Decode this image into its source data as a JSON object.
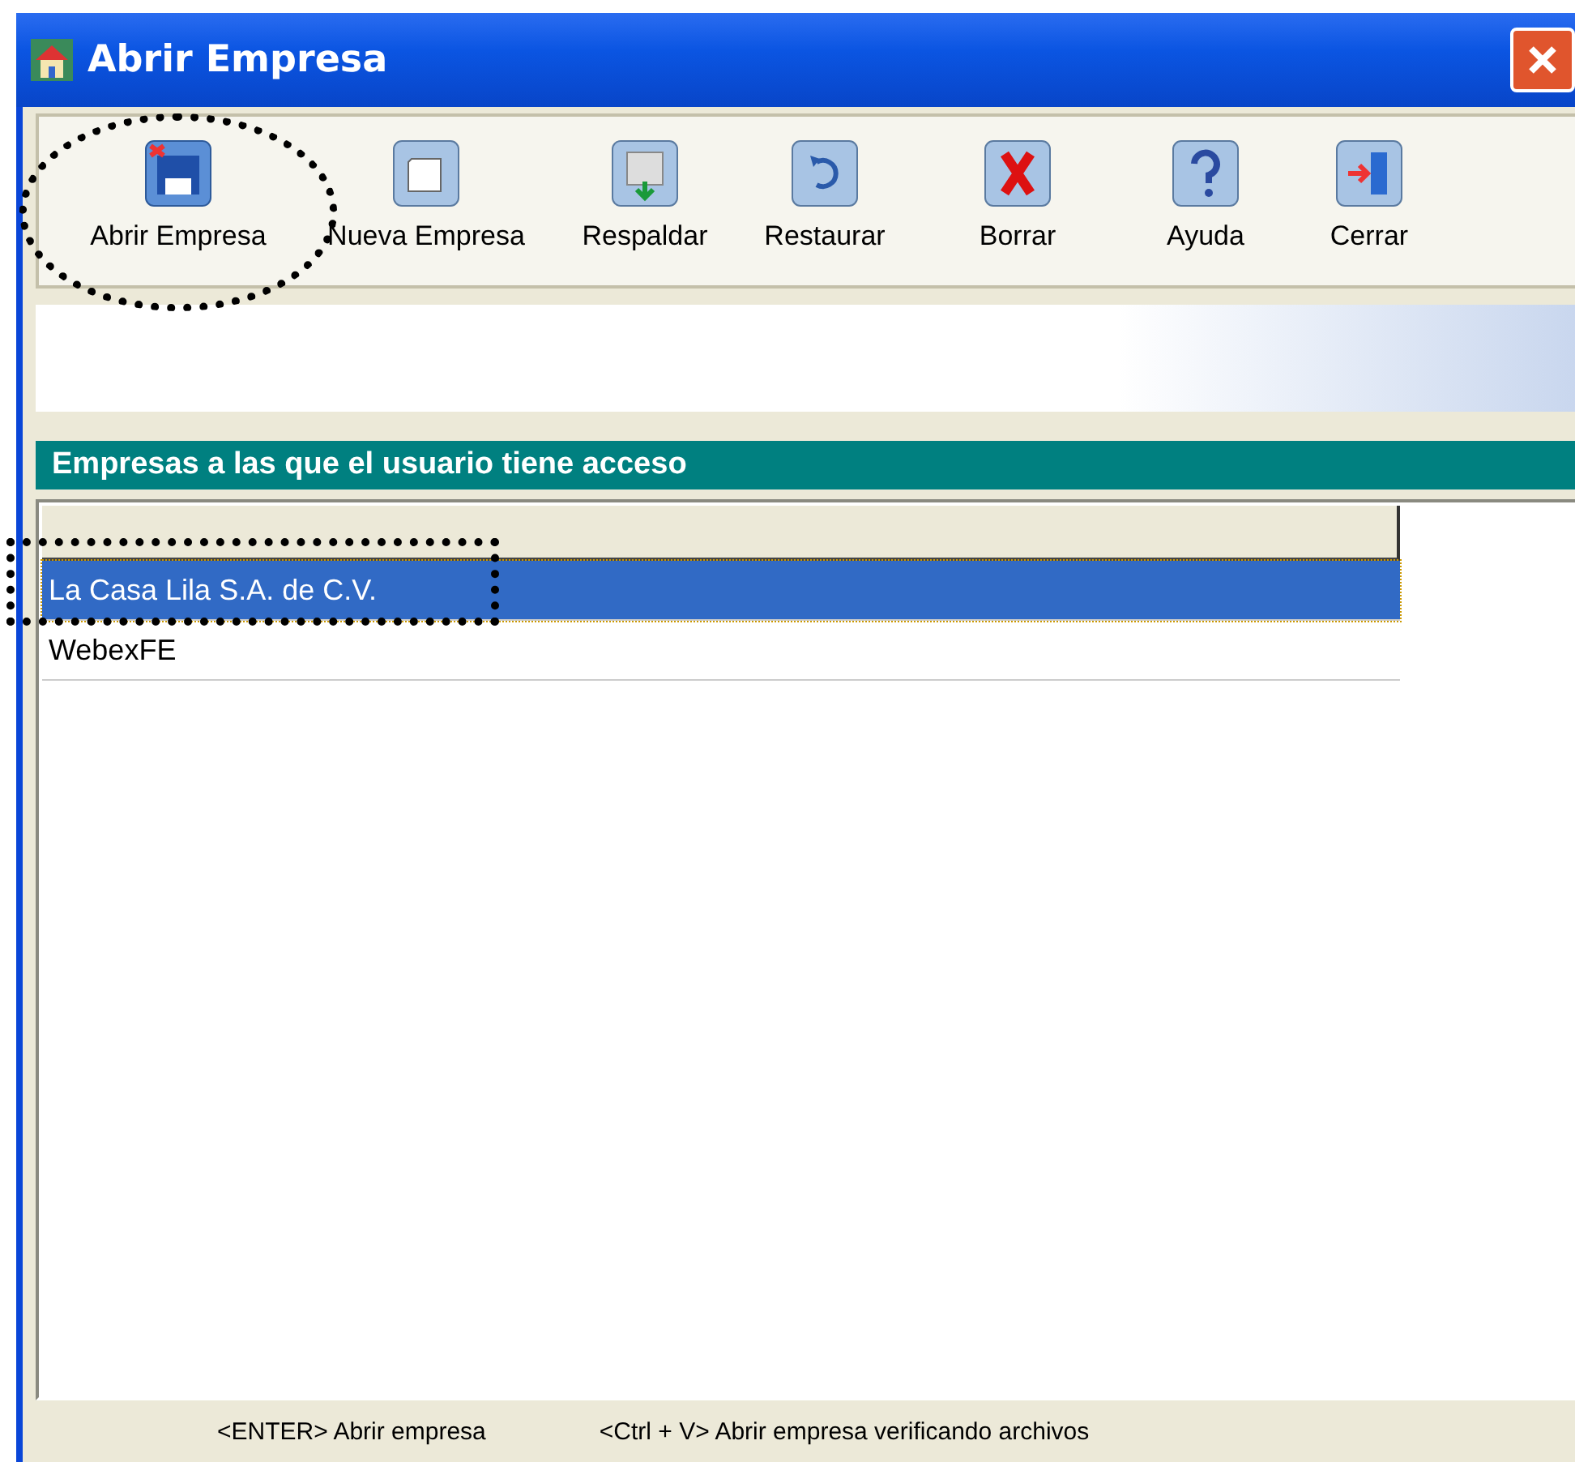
{
  "window": {
    "title": "Abrir Empresa"
  },
  "toolbar": [
    {
      "label": "Abrir Empresa",
      "kind": "open",
      "annotated": true
    },
    {
      "label": "Nueva Empresa",
      "kind": "new",
      "annotated": false
    },
    {
      "label": "Respaldar",
      "kind": "backup",
      "annotated": false
    },
    {
      "label": "Restaurar",
      "kind": "restore",
      "annotated": false
    },
    {
      "label": "Borrar",
      "kind": "delete",
      "annotated": false
    },
    {
      "label": "Ayuda",
      "kind": "help",
      "annotated": false
    },
    {
      "label": "Cerrar",
      "kind": "close",
      "annotated": false
    }
  ],
  "list": {
    "title": "Empresas a las que el usuario tiene acceso",
    "rows": [
      {
        "name": "La Casa Lila S.A. de C.V.",
        "selected": true,
        "annotated": true
      },
      {
        "name": "WebexFE",
        "selected": false,
        "annotated": false
      }
    ]
  },
  "status_bar": [
    "<ENTER> Abrir empresa",
    "<Ctrl + V> Abrir empresa verificando archivos"
  ]
}
